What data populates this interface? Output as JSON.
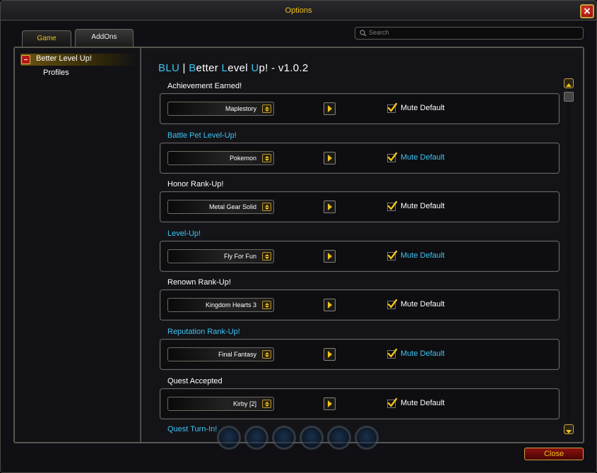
{
  "window": {
    "title": "Options"
  },
  "tabs": [
    {
      "label": "Game"
    },
    {
      "label": "AddOns"
    }
  ],
  "search": {
    "placeholder": "Search"
  },
  "sidebar": {
    "items": [
      {
        "label": "Better Level Up!",
        "active": true
      },
      {
        "label": "Profiles",
        "active": false
      }
    ]
  },
  "content": {
    "heading": {
      "p1": "B",
      "p2": "LU",
      "p3": " | ",
      "p4": "B",
      "p5": "etter ",
      "p6": "L",
      "p7": "evel ",
      "p8": "U",
      "p9": "p! - v1.0.2"
    },
    "sections": [
      {
        "label": "Achievement Earned!",
        "sound": "Maplestory",
        "mute_label": "Mute Default",
        "mute_checked": true,
        "color": "white"
      },
      {
        "label": "Battle Pet Level-Up!",
        "sound": "Pokemon",
        "mute_label": "Mute Default",
        "mute_checked": true,
        "color": "blue"
      },
      {
        "label": "Honor Rank-Up!",
        "sound": "Metal Gear Solid",
        "mute_label": "Mute Default",
        "mute_checked": true,
        "color": "white"
      },
      {
        "label": "Level-Up!",
        "sound": "Fly For Fun",
        "mute_label": "Mute Default",
        "mute_checked": true,
        "color": "blue"
      },
      {
        "label": "Renown Rank-Up!",
        "sound": "Kingdom Hearts 3",
        "mute_label": "Mute Default",
        "mute_checked": true,
        "color": "white"
      },
      {
        "label": "Reputation Rank-Up!",
        "sound": "Final Fantasy",
        "mute_label": "Mute Default",
        "mute_checked": true,
        "color": "blue"
      },
      {
        "label": "Quest Accepted",
        "sound": "Kirby [2]",
        "mute_label": "Mute Default",
        "mute_checked": true,
        "color": "white"
      }
    ],
    "partial_label": "Quest Turn-In!"
  },
  "footer": {
    "close_label": "Close"
  },
  "colors": {
    "accent_gold": "#f0c21a",
    "accent_blue": "#3ec4f3",
    "close_red": "#8a1010"
  }
}
